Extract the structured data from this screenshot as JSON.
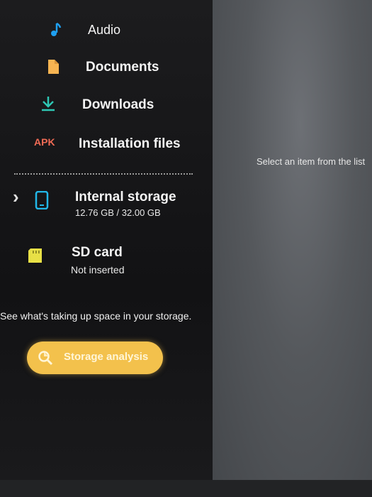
{
  "sidebar": {
    "items": [
      {
        "label": "Audio",
        "icon": "music-note-icon",
        "color": "#1fa0f0"
      },
      {
        "label": "Documents",
        "icon": "document-icon",
        "color": "#f6b452"
      },
      {
        "label": "Downloads",
        "icon": "download-icon",
        "color": "#2ec7b4"
      },
      {
        "label": "Installation files",
        "icon": "apk-icon",
        "icon_text": "APK",
        "color": "#f06b55"
      }
    ],
    "storage": [
      {
        "title": "Internal storage",
        "subtitle": "12.76 GB / 32.00 GB",
        "icon": "phone-storage-icon",
        "color": "#22b7e8",
        "chevron": "›"
      },
      {
        "title": "SD card",
        "subtitle": "Not inserted",
        "icon": "sd-card-icon",
        "color": "#e8e046"
      }
    ],
    "analysis": {
      "description": "See what's taking up space in your storage.",
      "button_label": "Storage analysis",
      "button_color": "#f3c14c"
    }
  },
  "detail": {
    "hint": "Select an item from the list"
  }
}
